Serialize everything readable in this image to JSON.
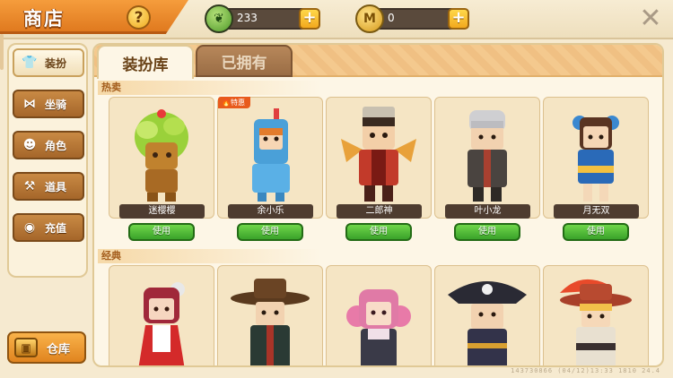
{
  "header": {
    "title": "商店",
    "help_icon": "question-mark-icon",
    "green_currency": {
      "icon": "leaf-coin-icon",
      "value": "233"
    },
    "gold_currency": {
      "icon": "m-coin-icon",
      "value": "0"
    },
    "plus_label": "+",
    "close_icon": "close-x-icon"
  },
  "sidebar": {
    "items": [
      {
        "label": "装扮",
        "icon": "shirt-icon",
        "active": true
      },
      {
        "label": "坐骑",
        "icon": "wings-icon",
        "active": false
      },
      {
        "label": "角色",
        "icon": "character-icon",
        "active": false
      },
      {
        "label": "道具",
        "icon": "items-icon",
        "active": false
      },
      {
        "label": "充值",
        "icon": "coins-icon",
        "active": false
      }
    ],
    "warehouse_label": "仓库"
  },
  "tabs": [
    {
      "label": "装扮库",
      "active": true
    },
    {
      "label": "已拥有",
      "active": false
    }
  ],
  "sections": {
    "hot": {
      "label": "热卖",
      "items": [
        {
          "name": "迷樱樱",
          "button": "使用",
          "tag": ""
        },
        {
          "name": "余小乐",
          "button": "使用",
          "tag": "特惠"
        },
        {
          "name": "二郎神",
          "button": "使用",
          "tag": ""
        },
        {
          "name": "叶小龙",
          "button": "使用",
          "tag": ""
        },
        {
          "name": "月无双",
          "button": "使用",
          "tag": ""
        }
      ]
    },
    "classic": {
      "label": "经典",
      "items": [
        {
          "name": "maid-girl-portrait"
        },
        {
          "name": "cowboy-hat-portrait"
        },
        {
          "name": "pink-hair-portrait"
        },
        {
          "name": "pirate-portrait"
        },
        {
          "name": "feather-hat-portrait"
        }
      ]
    }
  },
  "footer": {
    "info": "143730866   (04/12)13:33   1810 24.4"
  },
  "colors": {
    "accent_orange": "#e07a1f",
    "use_green": "#3aa22a",
    "nameplate": "#4e3c30"
  }
}
